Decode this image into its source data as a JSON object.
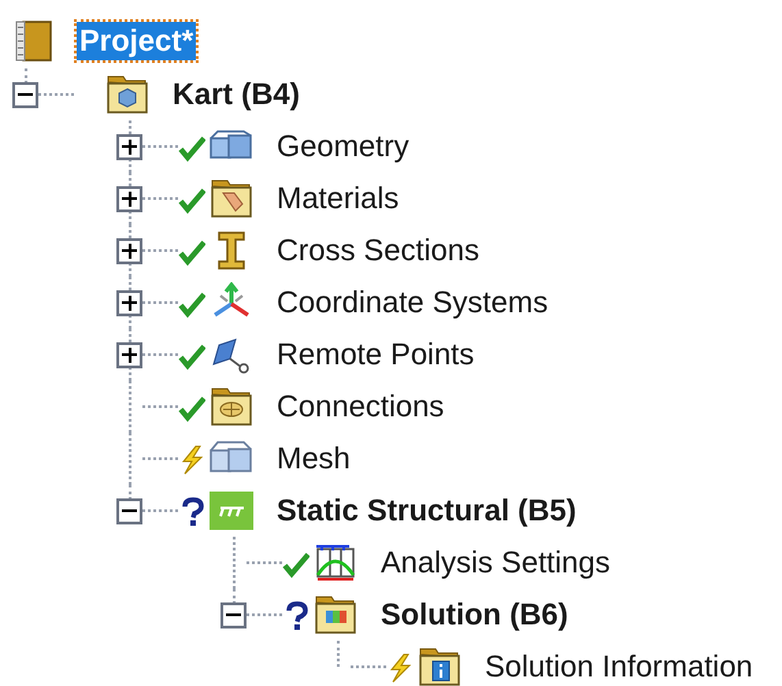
{
  "tree": {
    "label": "Project*",
    "bold": true,
    "selected": true,
    "icon": {
      "kind": "book"
    },
    "children": [
      {
        "label": "Kart (B4)",
        "bold": true,
        "selected": false,
        "expanded": true,
        "icon": {
          "kind": "model-folder"
        },
        "children": [
          {
            "label": "Geometry",
            "bold": false,
            "selected": false,
            "expanded": false,
            "status": {
              "kind": "ok"
            },
            "icon": {
              "kind": "cubes"
            }
          },
          {
            "label": "Materials",
            "bold": false,
            "selected": false,
            "expanded": false,
            "status": {
              "kind": "ok"
            },
            "icon": {
              "kind": "materials-folder"
            }
          },
          {
            "label": "Cross Sections",
            "bold": false,
            "selected": false,
            "expanded": false,
            "status": {
              "kind": "ok"
            },
            "icon": {
              "kind": "beam"
            }
          },
          {
            "label": "Coordinate Systems",
            "bold": false,
            "selected": false,
            "expanded": false,
            "status": {
              "kind": "ok"
            },
            "icon": {
              "kind": "axes"
            }
          },
          {
            "label": "Remote Points",
            "bold": false,
            "selected": false,
            "expanded": false,
            "status": {
              "kind": "ok"
            },
            "icon": {
              "kind": "remote-point"
            }
          },
          {
            "label": "Connections",
            "bold": false,
            "selected": false,
            "status": {
              "kind": "ok"
            },
            "icon": {
              "kind": "connections-folder"
            }
          },
          {
            "label": "Mesh",
            "bold": false,
            "selected": false,
            "status": {
              "kind": "pending"
            },
            "icon": {
              "kind": "mesh"
            }
          },
          {
            "label": "Static Structural (B5)",
            "bold": true,
            "selected": false,
            "expanded": true,
            "status": {
              "kind": "unknown"
            },
            "icon": {
              "kind": "static"
            },
            "children": [
              {
                "label": "Analysis Settings",
                "bold": false,
                "selected": false,
                "status": {
                  "kind": "ok"
                },
                "icon": {
                  "kind": "analysis"
                }
              },
              {
                "label": "Solution (B6)",
                "bold": true,
                "selected": false,
                "expanded": true,
                "status": {
                  "kind": "unknown"
                },
                "icon": {
                  "kind": "solution-folder"
                },
                "children": [
                  {
                    "label": "Solution Information",
                    "bold": false,
                    "selected": false,
                    "status": {
                      "kind": "pending"
                    },
                    "icon": {
                      "kind": "info-folder"
                    }
                  }
                ]
              }
            ]
          }
        ]
      }
    ]
  }
}
